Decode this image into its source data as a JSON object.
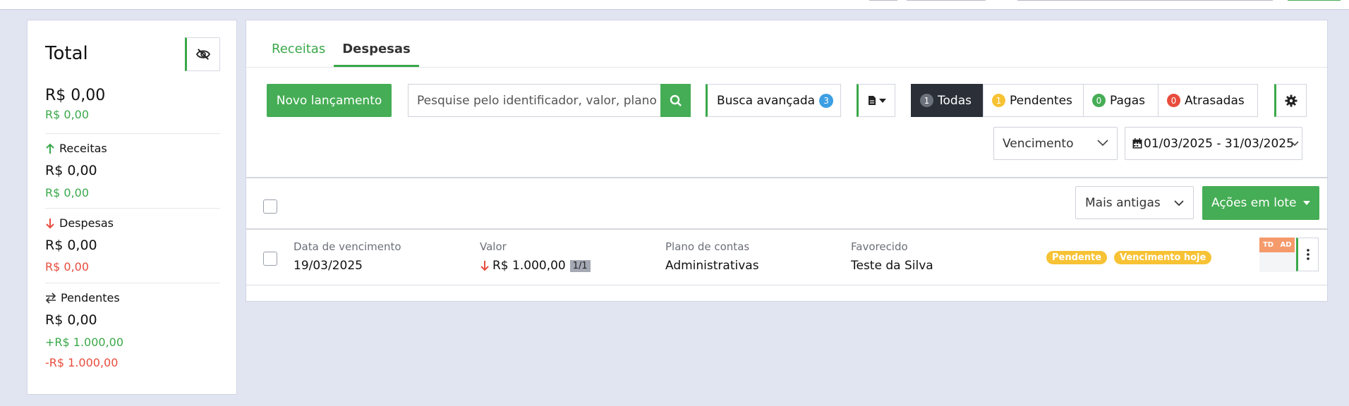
{
  "summary": {
    "title": "Total",
    "total_value": "R$ 0,00",
    "total_sub": "R$ 0,00",
    "receitas": {
      "label": "Receitas",
      "value": "R$ 0,00",
      "sub": "R$ 0,00"
    },
    "despesas": {
      "label": "Despesas",
      "value": "R$ 0,00",
      "sub": "R$ 0,00"
    },
    "pendentes": {
      "label": "Pendentes",
      "value": "R$ 0,00",
      "plus": "+R$ 1.000,00",
      "minus": "-R$ 1.000,00"
    }
  },
  "tabs": [
    {
      "label": "Receitas",
      "active": false
    },
    {
      "label": "Despesas",
      "active": true
    }
  ],
  "toolbar": {
    "new_label": "Novo lançamento",
    "search_placeholder": "Pesquise pelo identificador, valor, plano",
    "advanced_label": "Busca avançada",
    "advanced_count": "3",
    "filters": [
      {
        "label": "Todas",
        "count": "1",
        "color": "#6c727c",
        "active": true
      },
      {
        "label": "Pendentes",
        "count": "1",
        "color": "#f7c234",
        "active": false
      },
      {
        "label": "Pagas",
        "count": "0",
        "color": "#45ad55",
        "active": false
      },
      {
        "label": "Atrasadas",
        "count": "0",
        "color": "#e84c3d",
        "active": false
      }
    ],
    "date_type": "Vencimento",
    "date_range": "01/03/2025 - 31/03/2025"
  },
  "list": {
    "sort_label": "Mais antigas",
    "batch_label": "Ações em lote",
    "columns": {
      "due": "Data de vencimento",
      "value": "Valor",
      "account": "Plano de contas",
      "payee": "Favorecido"
    },
    "rows": [
      {
        "due": "19/03/2025",
        "value": "R$ 1.000,00",
        "installment": "1/1",
        "account": "Administrativas",
        "payee": "Teste da Silva",
        "status": "Pendente",
        "due_tag": "Vencimento hoje",
        "tags": [
          "TD",
          "AD"
        ]
      }
    ]
  },
  "colors": {
    "accent": "#45ad55",
    "danger": "#e84c3d",
    "warning": "#f7c234",
    "info": "#3d9fe3",
    "dark": "#2b3038"
  }
}
